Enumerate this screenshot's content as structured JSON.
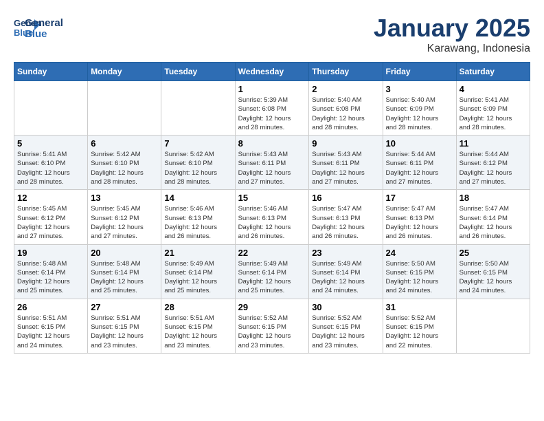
{
  "header": {
    "logo_line1": "General",
    "logo_line2": "Blue",
    "month": "January 2025",
    "location": "Karawang, Indonesia"
  },
  "weekdays": [
    "Sunday",
    "Monday",
    "Tuesday",
    "Wednesday",
    "Thursday",
    "Friday",
    "Saturday"
  ],
  "weeks": [
    [
      {
        "day": "",
        "info": ""
      },
      {
        "day": "",
        "info": ""
      },
      {
        "day": "",
        "info": ""
      },
      {
        "day": "1",
        "info": "Sunrise: 5:39 AM\nSunset: 6:08 PM\nDaylight: 12 hours\nand 28 minutes."
      },
      {
        "day": "2",
        "info": "Sunrise: 5:40 AM\nSunset: 6:08 PM\nDaylight: 12 hours\nand 28 minutes."
      },
      {
        "day": "3",
        "info": "Sunrise: 5:40 AM\nSunset: 6:09 PM\nDaylight: 12 hours\nand 28 minutes."
      },
      {
        "day": "4",
        "info": "Sunrise: 5:41 AM\nSunset: 6:09 PM\nDaylight: 12 hours\nand 28 minutes."
      }
    ],
    [
      {
        "day": "5",
        "info": "Sunrise: 5:41 AM\nSunset: 6:10 PM\nDaylight: 12 hours\nand 28 minutes."
      },
      {
        "day": "6",
        "info": "Sunrise: 5:42 AM\nSunset: 6:10 PM\nDaylight: 12 hours\nand 28 minutes."
      },
      {
        "day": "7",
        "info": "Sunrise: 5:42 AM\nSunset: 6:10 PM\nDaylight: 12 hours\nand 28 minutes."
      },
      {
        "day": "8",
        "info": "Sunrise: 5:43 AM\nSunset: 6:11 PM\nDaylight: 12 hours\nand 27 minutes."
      },
      {
        "day": "9",
        "info": "Sunrise: 5:43 AM\nSunset: 6:11 PM\nDaylight: 12 hours\nand 27 minutes."
      },
      {
        "day": "10",
        "info": "Sunrise: 5:44 AM\nSunset: 6:11 PM\nDaylight: 12 hours\nand 27 minutes."
      },
      {
        "day": "11",
        "info": "Sunrise: 5:44 AM\nSunset: 6:12 PM\nDaylight: 12 hours\nand 27 minutes."
      }
    ],
    [
      {
        "day": "12",
        "info": "Sunrise: 5:45 AM\nSunset: 6:12 PM\nDaylight: 12 hours\nand 27 minutes."
      },
      {
        "day": "13",
        "info": "Sunrise: 5:45 AM\nSunset: 6:12 PM\nDaylight: 12 hours\nand 27 minutes."
      },
      {
        "day": "14",
        "info": "Sunrise: 5:46 AM\nSunset: 6:13 PM\nDaylight: 12 hours\nand 26 minutes."
      },
      {
        "day": "15",
        "info": "Sunrise: 5:46 AM\nSunset: 6:13 PM\nDaylight: 12 hours\nand 26 minutes."
      },
      {
        "day": "16",
        "info": "Sunrise: 5:47 AM\nSunset: 6:13 PM\nDaylight: 12 hours\nand 26 minutes."
      },
      {
        "day": "17",
        "info": "Sunrise: 5:47 AM\nSunset: 6:13 PM\nDaylight: 12 hours\nand 26 minutes."
      },
      {
        "day": "18",
        "info": "Sunrise: 5:47 AM\nSunset: 6:14 PM\nDaylight: 12 hours\nand 26 minutes."
      }
    ],
    [
      {
        "day": "19",
        "info": "Sunrise: 5:48 AM\nSunset: 6:14 PM\nDaylight: 12 hours\nand 25 minutes."
      },
      {
        "day": "20",
        "info": "Sunrise: 5:48 AM\nSunset: 6:14 PM\nDaylight: 12 hours\nand 25 minutes."
      },
      {
        "day": "21",
        "info": "Sunrise: 5:49 AM\nSunset: 6:14 PM\nDaylight: 12 hours\nand 25 minutes."
      },
      {
        "day": "22",
        "info": "Sunrise: 5:49 AM\nSunset: 6:14 PM\nDaylight: 12 hours\nand 25 minutes."
      },
      {
        "day": "23",
        "info": "Sunrise: 5:49 AM\nSunset: 6:14 PM\nDaylight: 12 hours\nand 24 minutes."
      },
      {
        "day": "24",
        "info": "Sunrise: 5:50 AM\nSunset: 6:15 PM\nDaylight: 12 hours\nand 24 minutes."
      },
      {
        "day": "25",
        "info": "Sunrise: 5:50 AM\nSunset: 6:15 PM\nDaylight: 12 hours\nand 24 minutes."
      }
    ],
    [
      {
        "day": "26",
        "info": "Sunrise: 5:51 AM\nSunset: 6:15 PM\nDaylight: 12 hours\nand 24 minutes."
      },
      {
        "day": "27",
        "info": "Sunrise: 5:51 AM\nSunset: 6:15 PM\nDaylight: 12 hours\nand 23 minutes."
      },
      {
        "day": "28",
        "info": "Sunrise: 5:51 AM\nSunset: 6:15 PM\nDaylight: 12 hours\nand 23 minutes."
      },
      {
        "day": "29",
        "info": "Sunrise: 5:52 AM\nSunset: 6:15 PM\nDaylight: 12 hours\nand 23 minutes."
      },
      {
        "day": "30",
        "info": "Sunrise: 5:52 AM\nSunset: 6:15 PM\nDaylight: 12 hours\nand 23 minutes."
      },
      {
        "day": "31",
        "info": "Sunrise: 5:52 AM\nSunset: 6:15 PM\nDaylight: 12 hours\nand 22 minutes."
      },
      {
        "day": "",
        "info": ""
      }
    ]
  ]
}
